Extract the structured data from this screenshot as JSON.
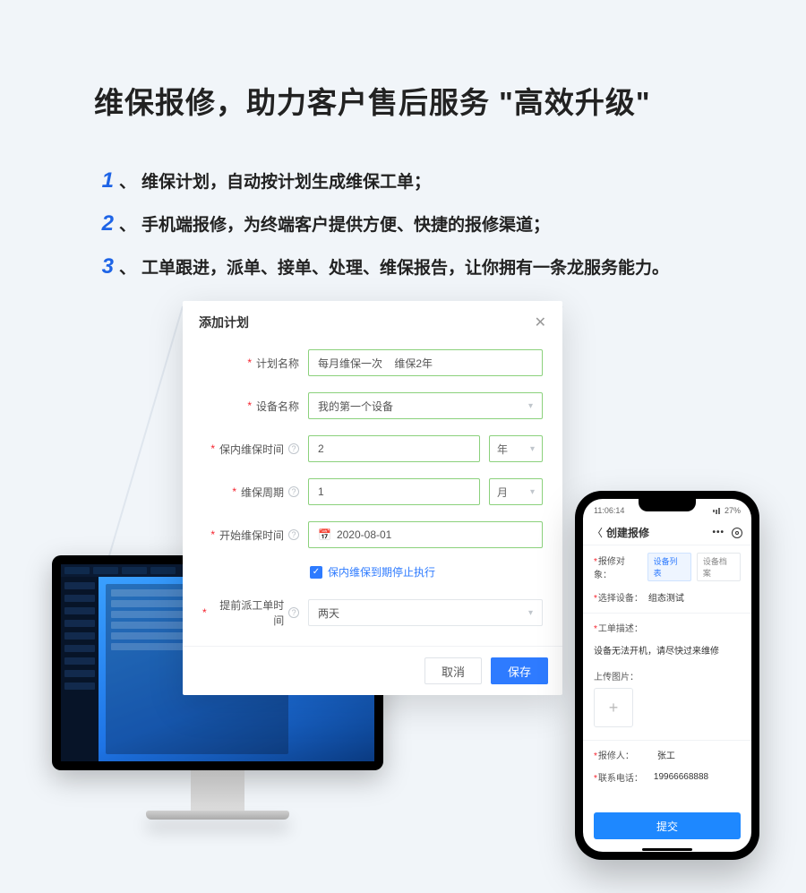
{
  "hero": {
    "title": "维保报修，助力客户售后服务 \"高效升级\""
  },
  "bullets": [
    {
      "num": "1",
      "text": "维保计划，自动按计划生成维保工单；"
    },
    {
      "num": "2",
      "text": "手机端报修，为终端客户提供方便、快捷的报修渠道；"
    },
    {
      "num": "3",
      "text": "工单跟进，派单、接单、处理、维保报告，让你拥有一条龙服务能力。"
    }
  ],
  "modal": {
    "title": "添加计划",
    "fields": {
      "plan_name_label": "计划名称",
      "plan_name_value": "每月维保一次    维保2年",
      "device_label": "设备名称",
      "device_value": "我的第一个设备",
      "inwarranty_label": "保内维保时间",
      "inwarranty_value": "2",
      "inwarranty_unit": "年",
      "cycle_label": "维保周期",
      "cycle_value": "1",
      "cycle_unit": "月",
      "start_label": "开始维保时间",
      "start_value": "2020-08-01",
      "checkbox_label": "保内维保到期停止执行",
      "ahead_label": "提前派工单时间",
      "ahead_value": "两天"
    },
    "buttons": {
      "cancel": "取消",
      "save": "保存"
    }
  },
  "phone": {
    "status_time": "11:06:14",
    "status_batt": "27%",
    "title": "创建报修",
    "target_label": "报修对象：",
    "tag_devlist": "设备列表",
    "tag_devfile": "设备档案",
    "device_label": "选择设备：",
    "device_value": "组态测试",
    "desc_label": "工单描述：",
    "desc_value": "设备无法开机，请尽快过来维修",
    "upload_label": "上传图片：",
    "reporter_label": "报修人：",
    "reporter_value": "张工",
    "phone_label": "联系电话：",
    "phone_value": "19966668888",
    "submit": "提交"
  }
}
